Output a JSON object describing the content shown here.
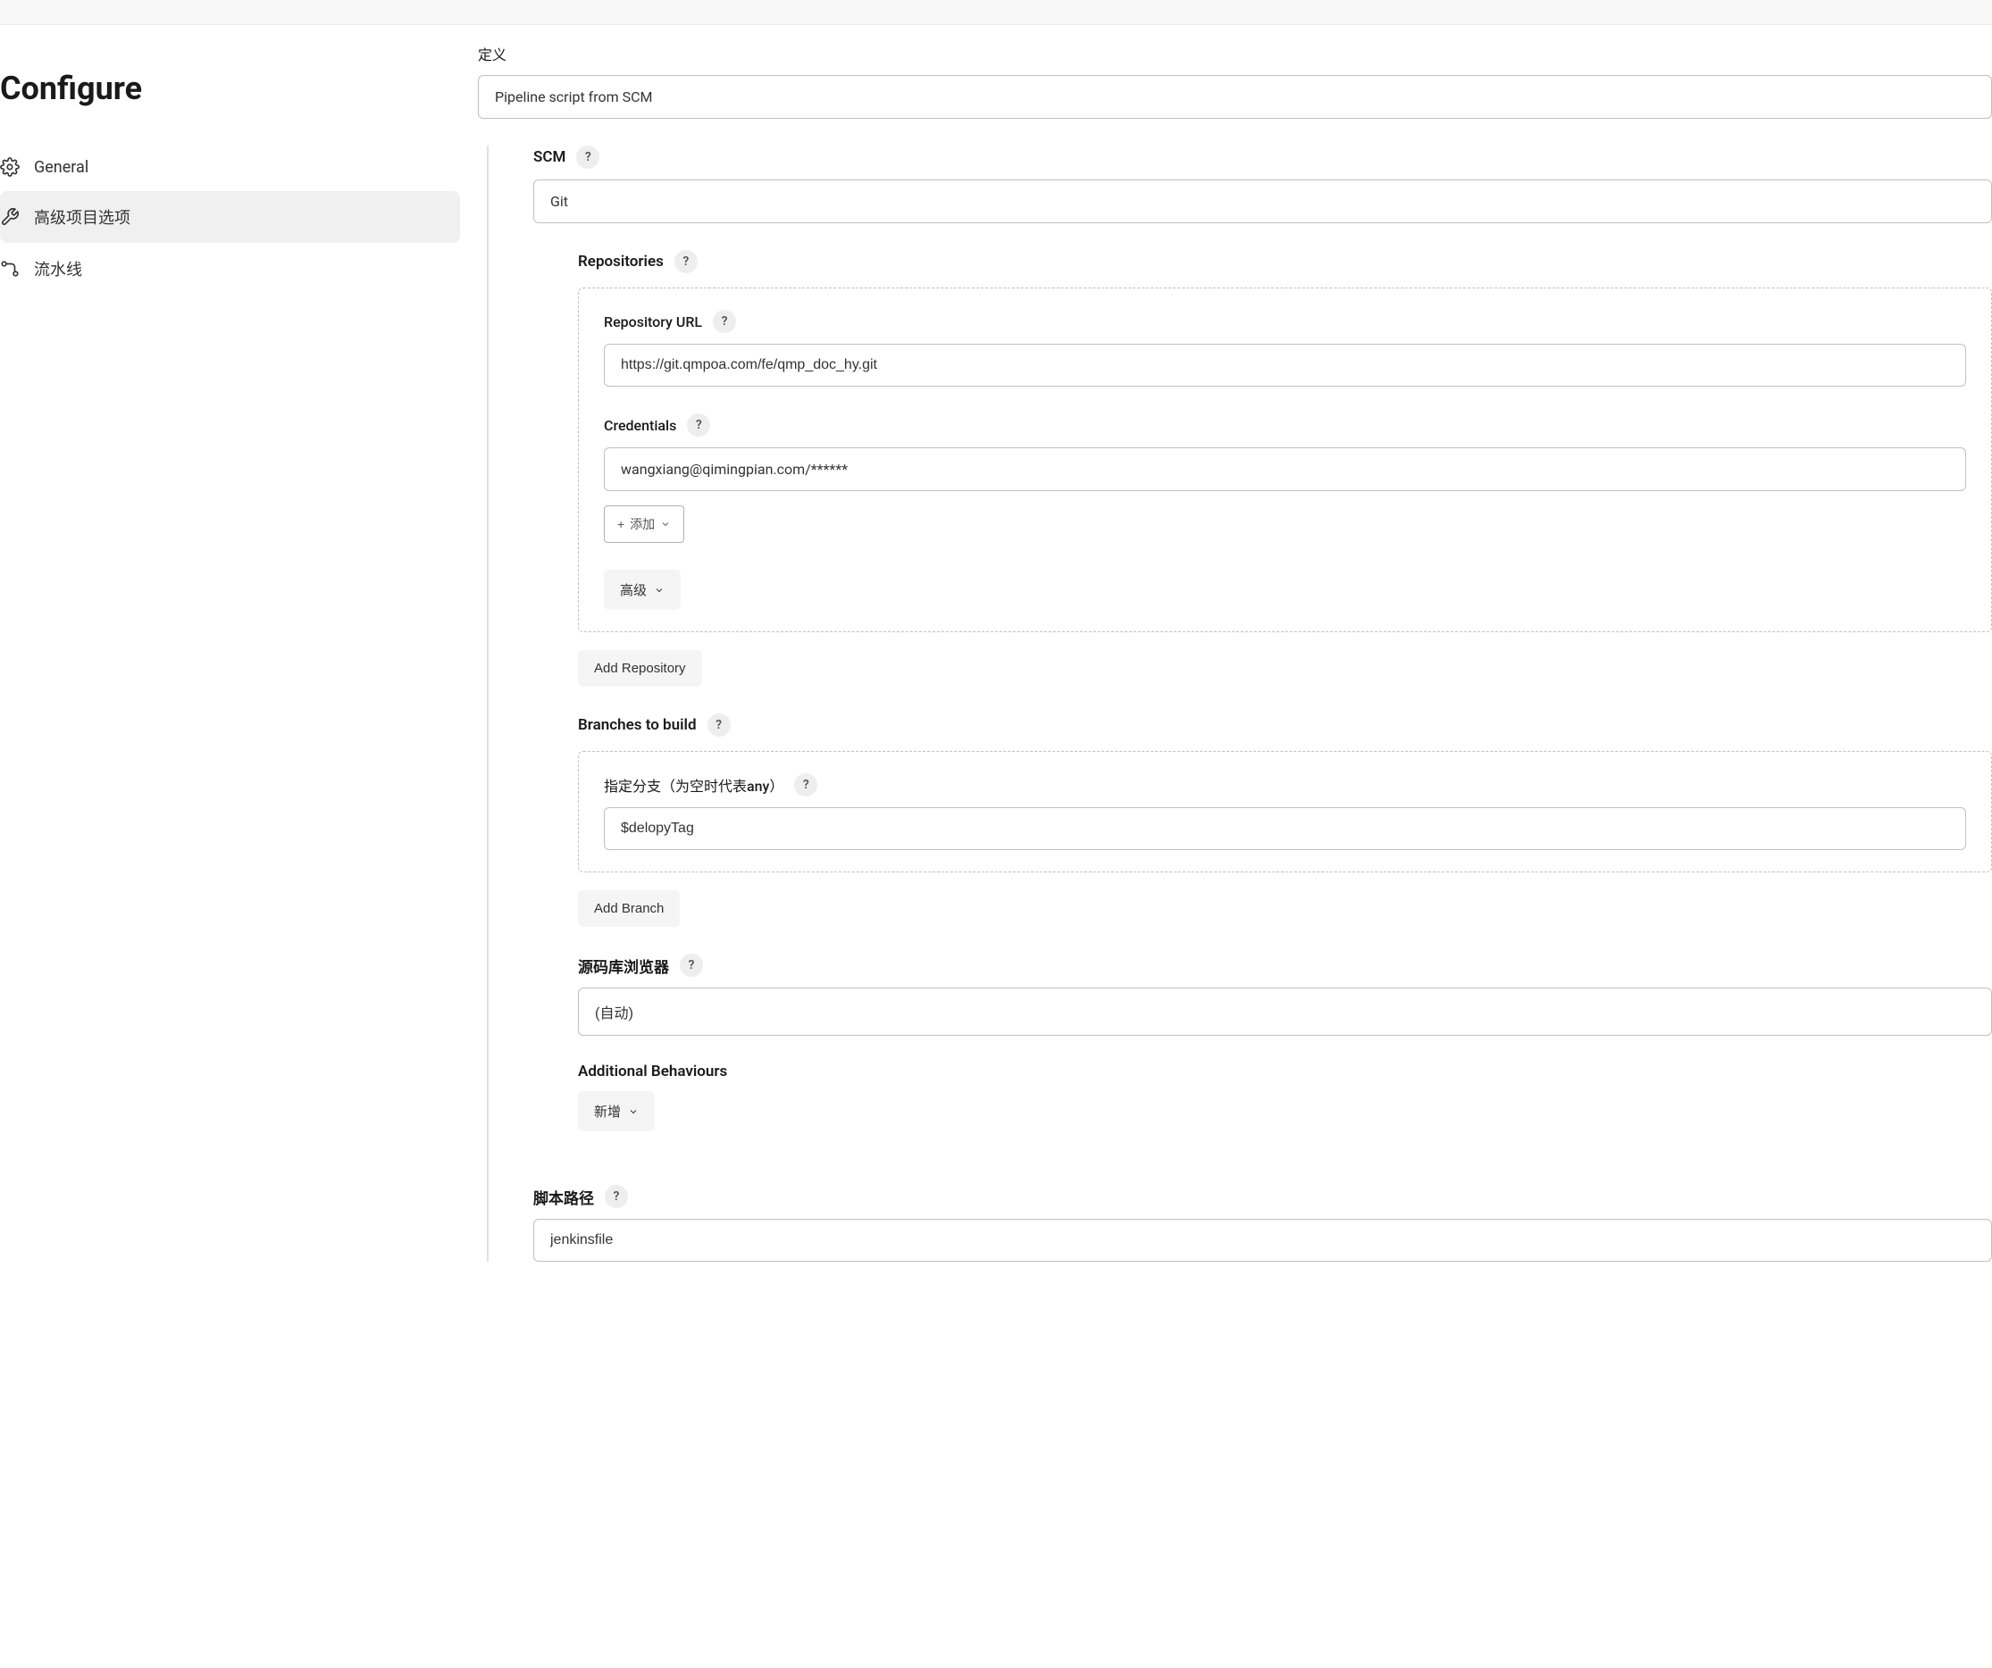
{
  "pageTitle": "Configure",
  "sidebar": {
    "items": [
      {
        "label": "General"
      },
      {
        "label": "高级项目选项"
      },
      {
        "label": "流水线"
      }
    ]
  },
  "definition": {
    "label": "定义",
    "value": "Pipeline script from SCM"
  },
  "scm": {
    "label": "SCM",
    "value": "Git"
  },
  "repositories": {
    "label": "Repositories",
    "repoUrl": {
      "label": "Repository URL",
      "value": "https://git.qmpoa.com/fe/qmp_doc_hy.git"
    },
    "credentials": {
      "label": "Credentials",
      "value": "wangxiang@qimingpian.com/******"
    },
    "addBtn": "添加",
    "advancedBtn": "高级",
    "addRepoBtn": "Add Repository"
  },
  "branches": {
    "label": "Branches to build",
    "specifier": {
      "label": "指定分支（为空时代表any）",
      "value": "$delopyTag"
    },
    "addBranchBtn": "Add Branch"
  },
  "repoBrowser": {
    "label": "源码库浏览器",
    "value": "(自动)"
  },
  "additionalBehaviours": {
    "label": "Additional Behaviours",
    "newBtn": "新增"
  },
  "scriptPath": {
    "label": "脚本路径",
    "value": "jenkinsfile"
  }
}
